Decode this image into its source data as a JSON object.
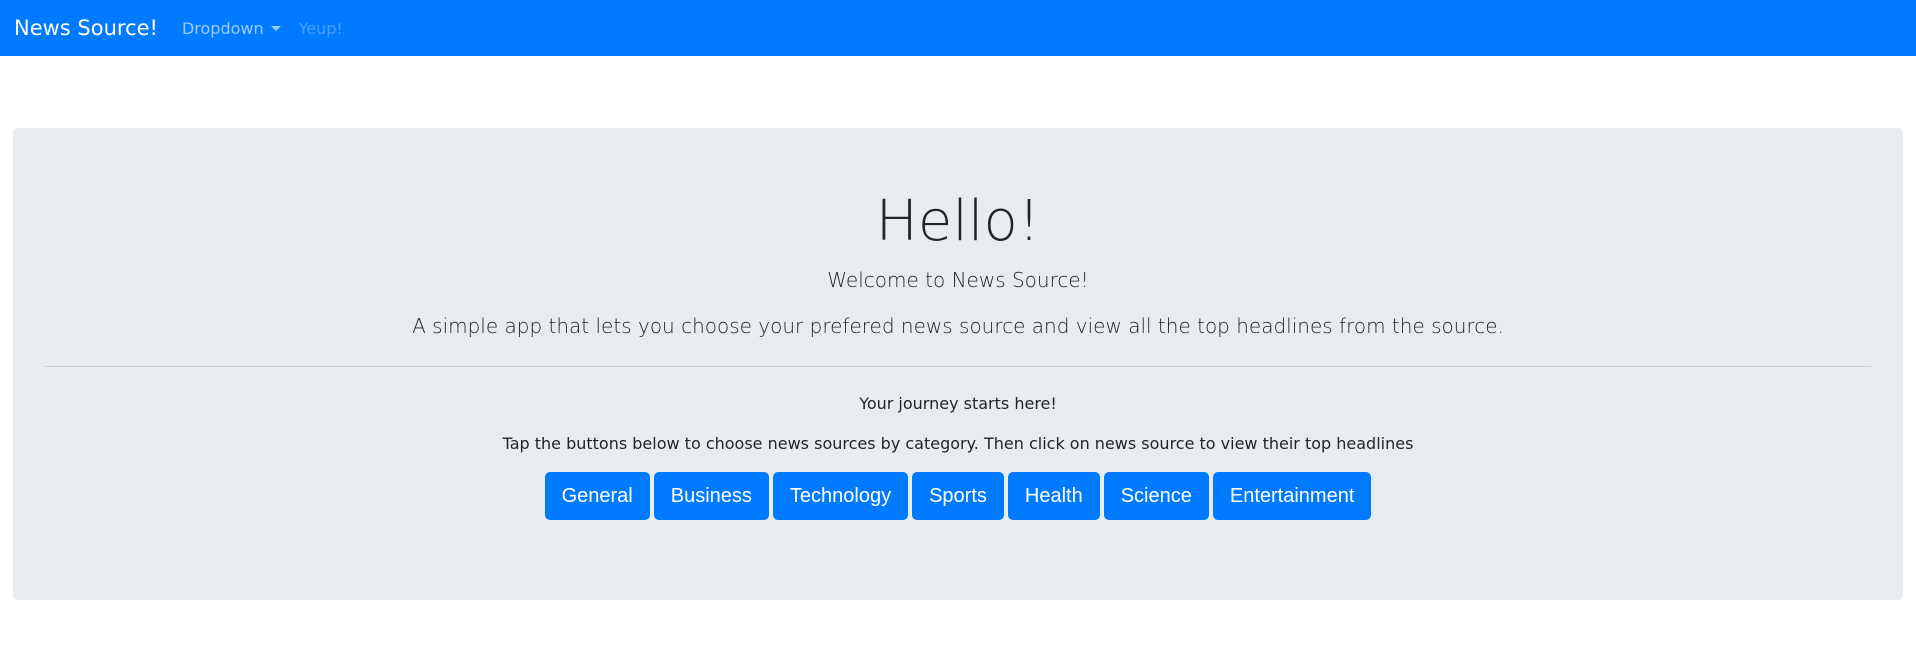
{
  "navbar": {
    "brand": "News Source!",
    "dropdown_label": "Dropdown",
    "disabled_link": "Yeup!"
  },
  "jumbotron": {
    "title": "Hello!",
    "welcome": "Welcome to News Source!",
    "lead": "A simple app that lets you choose your prefered news source and view all the top headlines from the source.",
    "journey": "Your journey starts here!",
    "instructions": "Tap the buttons below to choose news sources by category. Then click on news source to view their top headlines"
  },
  "categories": [
    {
      "label": "General"
    },
    {
      "label": "Business"
    },
    {
      "label": "Technology"
    },
    {
      "label": "Sports"
    },
    {
      "label": "Health"
    },
    {
      "label": "Science"
    },
    {
      "label": "Entertainment"
    }
  ],
  "colors": {
    "primary": "#007bff",
    "jumbotron_bg": "#e9ecef",
    "text": "#212529"
  }
}
